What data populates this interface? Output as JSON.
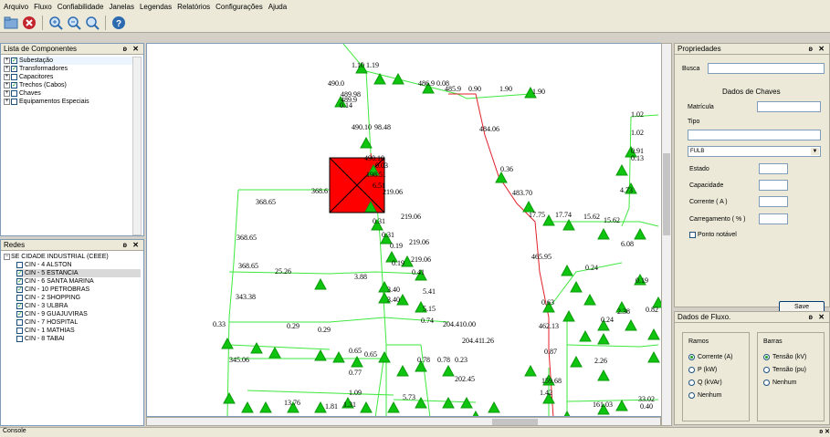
{
  "menu": [
    "Arquivo",
    "Fluxo",
    "Confiabilidade",
    "Janelas",
    "Legendas",
    "Relatórios",
    "Configurações",
    "Ajuda"
  ],
  "toolbar": {
    "icons": [
      "folder-icon",
      "close-red-icon",
      "zoom-in-icon",
      "zoom-out-icon",
      "zoom-fit-icon",
      "help-icon"
    ]
  },
  "components": {
    "title": "Lista de Componentes",
    "items": [
      {
        "label": "Subestação",
        "checked": true
      },
      {
        "label": "Transformadores",
        "checked": true
      },
      {
        "label": "Capacitores",
        "checked": false
      },
      {
        "label": "Trechos (Cabos)",
        "checked": true
      },
      {
        "label": "Chaves",
        "checked": false
      },
      {
        "label": "Equipamentos Especiais",
        "checked": false
      }
    ]
  },
  "redes": {
    "title": "Redes",
    "root": "SE CIDADE INDUSTRIAL (CEEE)",
    "items": [
      {
        "label": "CIN - 4 ALSTON",
        "checked": false
      },
      {
        "label": "CIN - 5 ESTANCIA",
        "checked": true,
        "selected": true
      },
      {
        "label": "CIN - 6 SANTA MARINA",
        "checked": true
      },
      {
        "label": "CIN - 10 PETROBRAS",
        "checked": true
      },
      {
        "label": "CIN - 2 SHOPPING",
        "checked": false
      },
      {
        "label": "CIN - 3 ULBRA",
        "checked": true
      },
      {
        "label": "CIN - 9 GUAJUVIRAS",
        "checked": true
      },
      {
        "label": "CIN - 7 HOSPITAL",
        "checked": false
      },
      {
        "label": "CIN - 1 MATHIAS",
        "checked": false
      },
      {
        "label": "CIN - 8 TABAI",
        "checked": false
      }
    ]
  },
  "props": {
    "title": "Propriedades",
    "busca_label": "Busca",
    "section": "Dados de Chaves",
    "matricula": "Matrícula",
    "tipo": "Tipo",
    "tipo_value": "FULB",
    "estado": "Estado",
    "capacidade": "Capacidade",
    "corrente": "Corrente ( A )",
    "carregamento": "Carregamento ( % )",
    "ponto": "Ponto notável",
    "save": "Save"
  },
  "fluxo": {
    "title": "Dados de Fluxo.",
    "ramos_title": "Ramos",
    "ramos": [
      "Corrente (A)",
      "P (kW)",
      "Q (kVAr)",
      "Nenhum"
    ],
    "barras_title": "Barras",
    "barras": [
      "Tensão (kV)",
      "Tensão (pu)",
      "Nenhum"
    ]
  },
  "console_title": "Console",
  "map_labels": [
    "1.10",
    "1.19",
    "490.0",
    "489.98",
    "489.9",
    "486.9",
    "0.08",
    "485.9",
    "0.90",
    "1.90",
    "1.90",
    "0.14",
    "490.10",
    "98.48",
    "484.06",
    "1.02",
    "1.02",
    "0.91",
    "0.13",
    "490.10",
    "0.03",
    "198.51",
    "0.36",
    "6.51",
    "368.65",
    "368.6",
    "219.06",
    "483.70",
    "4.73",
    "0.31",
    "219.06",
    "17.75",
    "17.74",
    "15.62",
    "15.62",
    "0.31",
    "219.06",
    "368.65",
    "6.08",
    "0.19",
    "465.95",
    "368.65",
    "25.26",
    "0.19",
    "3.88",
    "219.06",
    "0.41",
    "0.24",
    "0.19",
    "343.38",
    "3.40",
    "3.40",
    "5.41",
    "0.63",
    "2.38",
    "0.82",
    "5.15",
    "0.24",
    "0.33",
    "0.29",
    "0.29",
    "0.74",
    "204.41",
    "0.00",
    "462.13",
    "0.65",
    "0.65",
    "204.41",
    "1.26",
    "0.87",
    "345.06",
    "0.77",
    "0.78",
    "0.78",
    "0.23",
    "2.26",
    "202.45",
    "159.68",
    "1.09",
    "1.42",
    "13.76",
    "1.31",
    "5.73",
    "161.03",
    "33.02",
    "0.40",
    "1.81"
  ]
}
